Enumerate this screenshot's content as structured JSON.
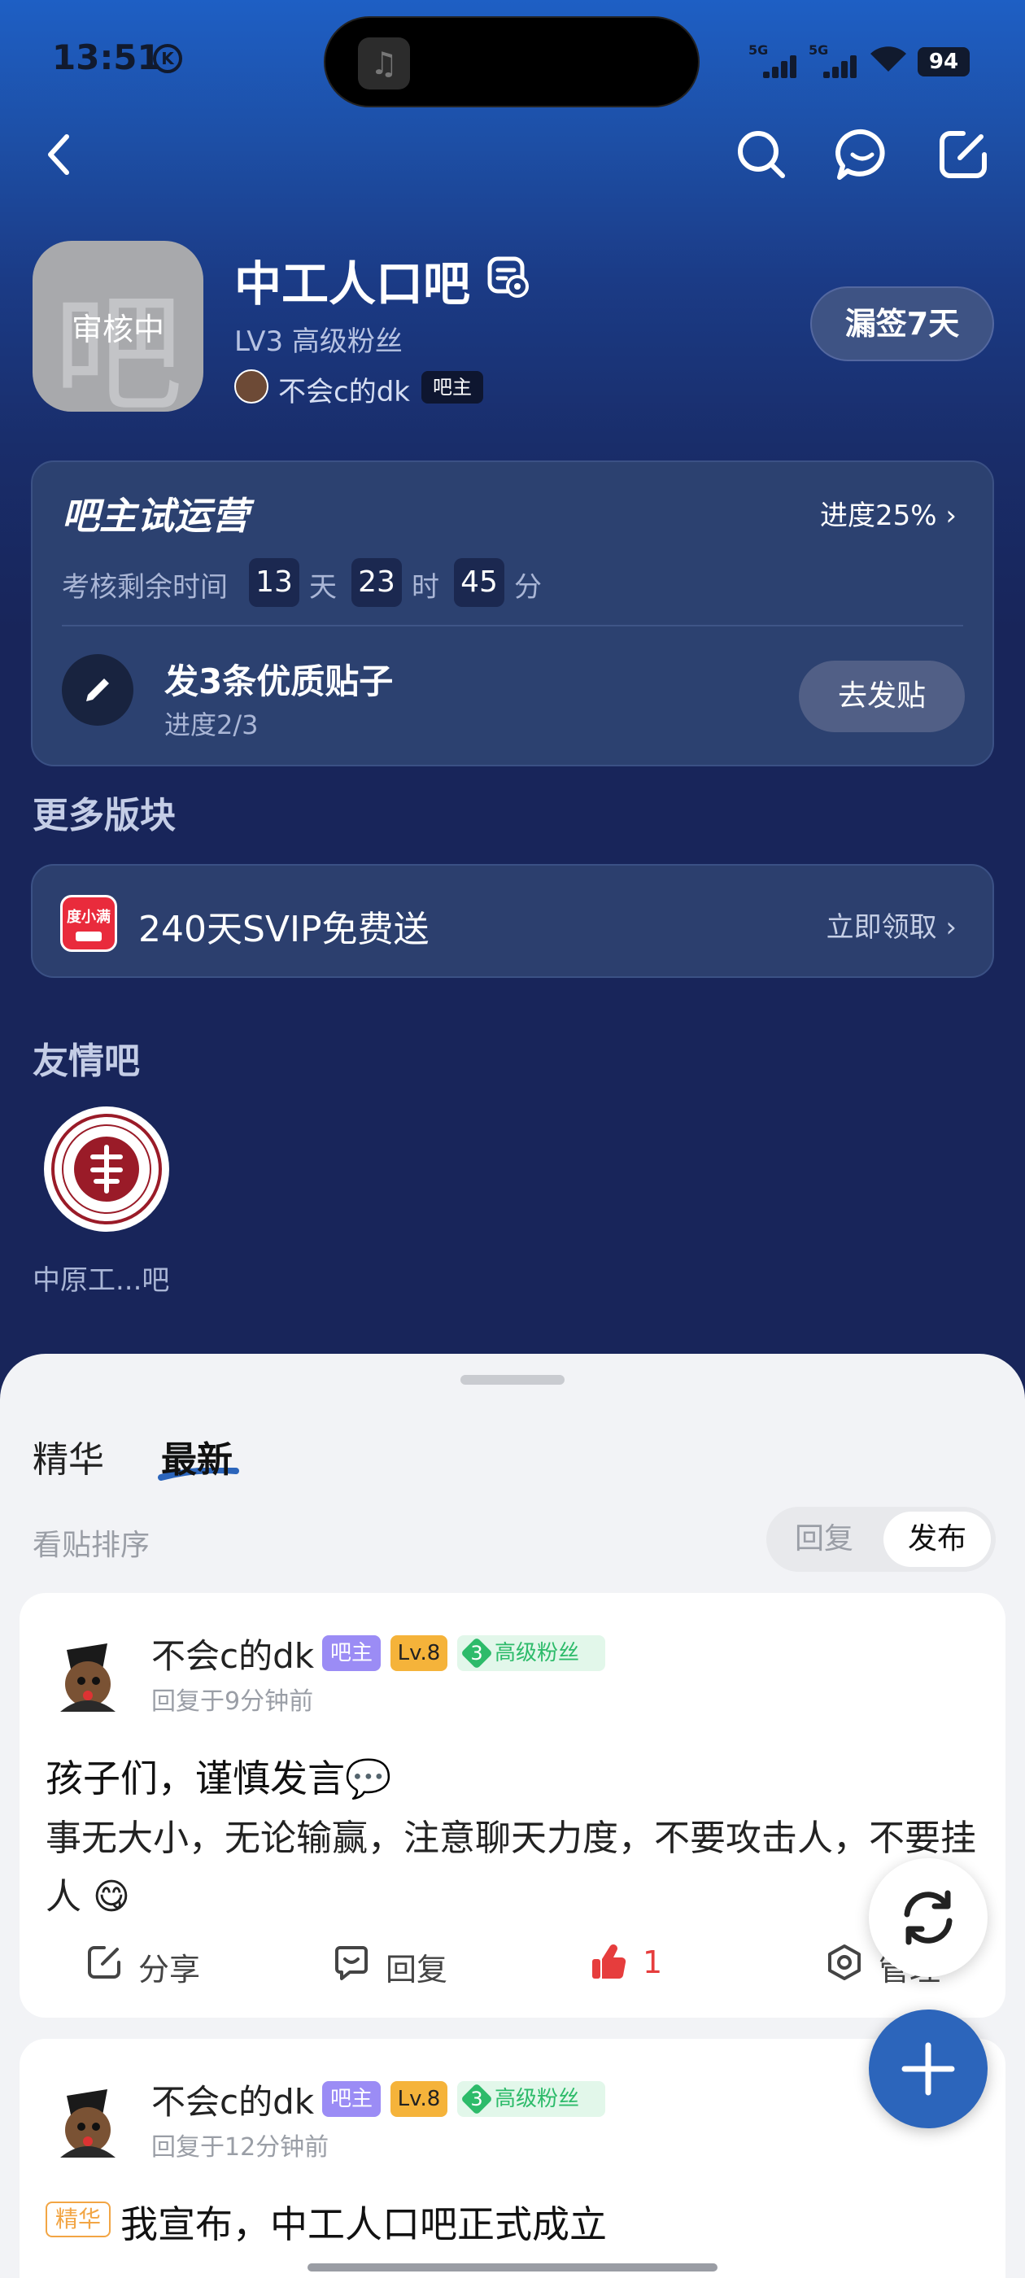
{
  "status_bar": {
    "time": "13:51",
    "time_badge": "K",
    "network_1": "5G",
    "network_2": "5G",
    "battery": "94"
  },
  "nav": {
    "back": "back-icon",
    "search": "search-icon",
    "message": "message-icon",
    "edit": "edit-icon"
  },
  "forum": {
    "avatar_char": "吧",
    "avatar_status": "审核中",
    "name": "中工人口吧",
    "level_text": "LV3 高级粉丝",
    "owner_name": "不会c的dk",
    "owner_badge": "吧主",
    "sign_button": "漏签7天"
  },
  "trial": {
    "title": "吧主试运营",
    "progress": "进度25%",
    "remain_label": "考核剩余时间",
    "days": "13",
    "day_unit": "天",
    "hours": "23",
    "hour_unit": "时",
    "minutes": "45",
    "minute_unit": "分",
    "task_title": "发3条优质贴子",
    "task_progress": "进度2/3",
    "task_button": "去发贴"
  },
  "more_sections": {
    "title": "更多版块",
    "promo_logo": "度小满",
    "promo_text": "240天SVIP免费送",
    "promo_link": "立即领取"
  },
  "friend_forums": {
    "title": "友情吧",
    "items": [
      {
        "name": "中原工...吧"
      }
    ]
  },
  "feed": {
    "tabs": [
      {
        "label": "精华"
      },
      {
        "label": "最新"
      }
    ],
    "active_tab": "最新",
    "sort_label": "看贴排序",
    "sort_options": [
      {
        "label": "回复"
      },
      {
        "label": "发布"
      }
    ],
    "sort_selected": "发布",
    "posts": [
      {
        "author": "不会c的dk",
        "badge_owner": "吧主",
        "badge_level": "Lv.8",
        "fan_level": "3",
        "fan_label": "高级粉丝",
        "time": "回复于9分钟前",
        "title": "孩子们，谨慎发言💬",
        "body": "事无大小，无论输赢，注意聊天力度，不要攻击人，不要挂人 😋",
        "actions": {
          "share": "分享",
          "reply": "回复",
          "likes": "1",
          "manage": "管理"
        }
      },
      {
        "author": "不会c的dk",
        "badge_owner": "吧主",
        "badge_level": "Lv.8",
        "fan_level": "3",
        "fan_label": "高级粉丝",
        "time": "回复于12分钟前",
        "essence_tag": "精华",
        "title": "我宣布，中工人口吧正式成立"
      }
    ]
  },
  "colors": {
    "accent_blue": "#2c65bb",
    "like_red": "#e63d3d",
    "fan_green": "#2dbb6a",
    "owner_purple": "#9b8cf5",
    "level_orange": "#f5b33a"
  }
}
